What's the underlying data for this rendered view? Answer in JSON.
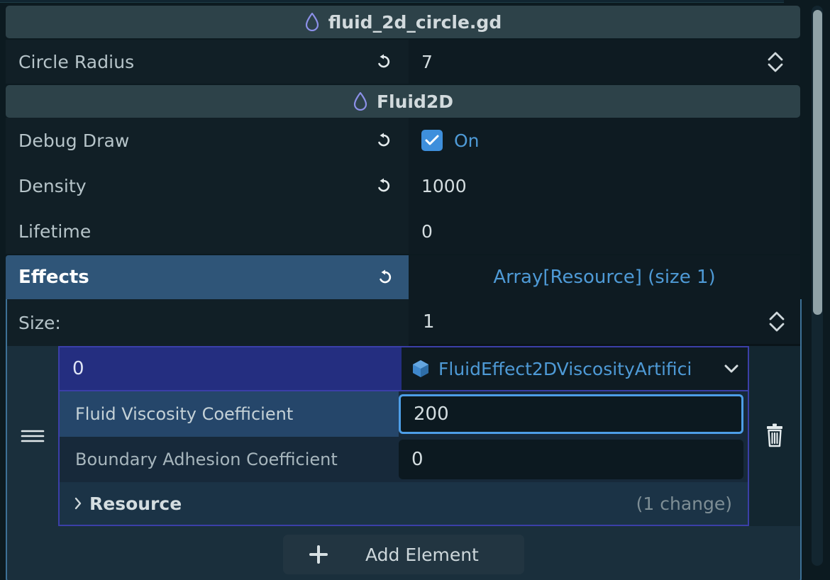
{
  "app": {
    "panel": "godot-inspector"
  },
  "script_header": {
    "icon": "fluid-drop-icon",
    "title": "fluid_2d_circle.gd"
  },
  "circle_radius": {
    "label": "Circle Radius",
    "value": "7",
    "revert_icon": "revert-arrow-icon",
    "spinner_icon": "updown-spinner-icon"
  },
  "class_header": {
    "icon": "fluid-drop-icon",
    "title": "Fluid2D"
  },
  "properties": [
    {
      "label": "Debug Draw",
      "value": "On",
      "has_revert": true,
      "has_checkbox": true,
      "checked": true
    },
    {
      "label": "Density",
      "value": "1000",
      "has_revert": true,
      "has_checkbox": false
    },
    {
      "label": "Lifetime",
      "value": "0",
      "has_revert": false,
      "has_checkbox": false
    }
  ],
  "effects": {
    "label": "Effects",
    "revert_icon": "revert-arrow-icon",
    "summary": "Array[Resource] (size 1)",
    "size_label": "Size:",
    "size_value": "1",
    "element": {
      "index": "0",
      "resource_icon": "resource-cube-icon",
      "resource_type": "FluidEffect2DViscosityArtifici",
      "dropdown_icon": "chevron-down-icon",
      "drag_handle_icon": "drag-handle-icon",
      "delete_icon": "trash-icon",
      "fields": [
        {
          "label": "Fluid Viscosity Coefficient",
          "value": "200",
          "selected": true,
          "focused": true
        },
        {
          "label": "Boundary Adhesion Coefficient",
          "value": "0",
          "selected": false,
          "focused": false
        }
      ],
      "sub_section": {
        "expand_icon": "chevron-right-icon",
        "label": "Resource",
        "changes": "(1 change)"
      }
    },
    "add_button": {
      "icon": "plus-icon",
      "label": "Add Element"
    }
  },
  "colors": {
    "accent_blue": "#4e9ad6",
    "focus_blue": "#4d9ee8",
    "selection_blue": "#2f5578",
    "index_indigo": "#242e80",
    "panel_bg": "#111f26",
    "header_bg": "#2d4249"
  }
}
